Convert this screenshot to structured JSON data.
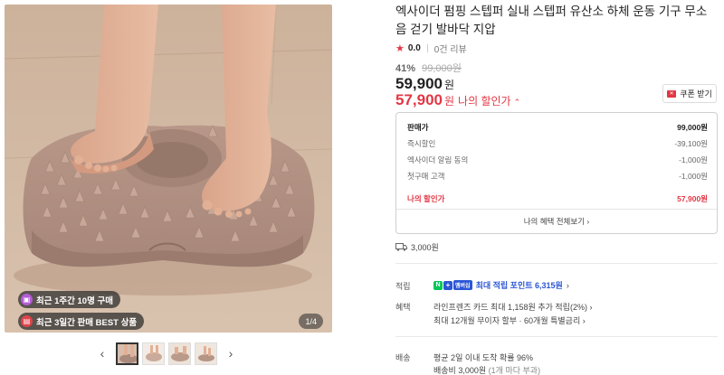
{
  "gallery": {
    "badges": [
      {
        "icon": "shopping-bag-icon",
        "text": "최근 1주간 10명 구매"
      },
      {
        "icon": "gift-icon",
        "text": "최근 3일간 판매 BEST 상품"
      }
    ],
    "counter": "1/4",
    "prev_icon": "chevron-left-icon",
    "next_icon": "chevron-right-icon",
    "thumbnail_count": 4,
    "active_thumbnail": 1
  },
  "product": {
    "title": "엑사이더 펌핑 스텝퍼 실내 스텝퍼 유산소 하체 운동 기구 무소음 걷기 발바닥 지압",
    "rating_score": "0.0",
    "review_count": "0건 리뷰",
    "discount_percent": "41%",
    "original_price": "99,000원",
    "sale_price": "59,900",
    "won": "원",
    "my_price": "57,900",
    "my_price_label": "나의 할인가",
    "coupon_label": "쿠폰 받기"
  },
  "breakdown": {
    "rows": [
      {
        "label": "판매가",
        "value": "99,000원"
      },
      {
        "label": "즉시할인",
        "value": "-39,100원"
      },
      {
        "label": "엑사이더 알림 동의",
        "value": "-1,000원"
      },
      {
        "label": "첫구매 고객",
        "value": "-1,000원"
      }
    ],
    "total_label": "나의 할인가",
    "total_value": "57,900원",
    "view_all": "나의 혜택 전체보기"
  },
  "shipping_fee": "3,000원",
  "points": {
    "label": "적립",
    "text": "최대 적립 포인트 6,315원",
    "badge_n": "N",
    "badge_plus": "+",
    "badge_mem": "멤버십"
  },
  "benefits": {
    "label": "혜택",
    "line1": "라인프렌즈 카드 최대 1,158원 추가 적립(2%)",
    "line2": "최대 12개월 무이자 할부 · 60개월 특별금리"
  },
  "delivery": {
    "label": "배송",
    "line1": "평균 2일 이내 도착 확률 96%",
    "line2": "배송비 3,000원",
    "line2_sub": "(1개 마다 부과)"
  },
  "colors": {
    "accent_red": "#e23744",
    "points_blue": "#2b56d6",
    "naver_green": "#03c75a"
  }
}
